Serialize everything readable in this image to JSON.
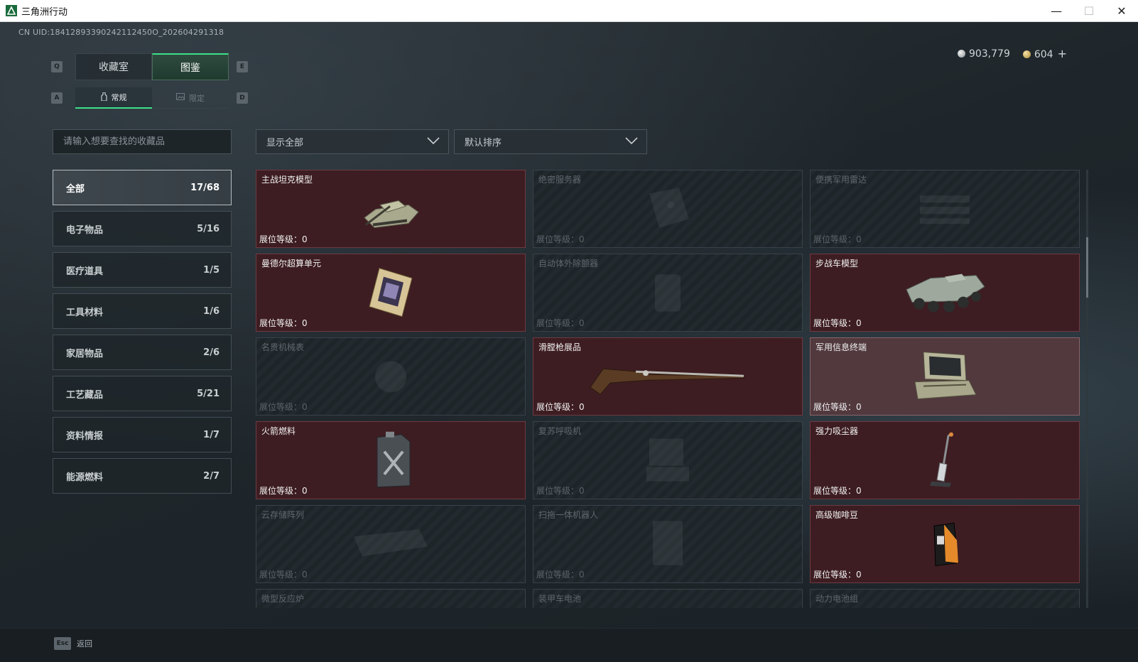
{
  "window": {
    "title": "三角洲行动",
    "minimize": "—",
    "maximize": "☐",
    "close": "✕"
  },
  "uid": "CN UID:18412893390242112450O_202604291318",
  "currency": {
    "silver": "903,779",
    "gold": "604",
    "add": "+"
  },
  "tabs_top": [
    {
      "label": "收藏室",
      "key": "Q",
      "active": false
    },
    {
      "label": "图鉴",
      "key": "E",
      "active": true
    }
  ],
  "tabs_sub": [
    {
      "label": "常规",
      "key": "A",
      "active": true
    },
    {
      "label": "限定",
      "key": "D",
      "active": false
    }
  ],
  "search": {
    "placeholder": "请输入想要查找的收藏品"
  },
  "filters": {
    "show": "显示全部",
    "sort": "默认排序"
  },
  "categories": [
    {
      "label": "全部",
      "count": "17/68",
      "active": true
    },
    {
      "label": "电子物品",
      "count": "5/16"
    },
    {
      "label": "医疗道具",
      "count": "1/5"
    },
    {
      "label": "工具材料",
      "count": "1/6"
    },
    {
      "label": "家居物品",
      "count": "2/6"
    },
    {
      "label": "工艺藏品",
      "count": "5/21"
    },
    {
      "label": "资料情报",
      "count": "1/7"
    },
    {
      "label": "能源燃料",
      "count": "2/7"
    }
  ],
  "level_label": "展位等级：",
  "items": [
    {
      "name": "主战坦克模型",
      "level": "0",
      "owned": true,
      "icon": "tank-icon"
    },
    {
      "name": "绝密服务器",
      "level": "0",
      "owned": false,
      "icon": "server-icon"
    },
    {
      "name": "便携军用雷达",
      "level": "0",
      "owned": false,
      "icon": "radar-icon"
    },
    {
      "name": "曼德尔超算单元",
      "level": "0",
      "owned": true,
      "icon": "cpu-icon"
    },
    {
      "name": "自动体外除颤器",
      "level": "0",
      "owned": false,
      "icon": "defibrillator-icon"
    },
    {
      "name": "步战车模型",
      "level": "0",
      "owned": true,
      "icon": "ifv-icon"
    },
    {
      "name": "名贵机械表",
      "level": "0",
      "owned": false,
      "icon": "watch-icon"
    },
    {
      "name": "滑膛枪展品",
      "level": "0",
      "owned": true,
      "icon": "musket-icon"
    },
    {
      "name": "军用信息终端",
      "level": "0",
      "owned": true,
      "highlighted": true,
      "icon": "terminal-icon"
    },
    {
      "name": "火箭燃料",
      "level": "0",
      "owned": true,
      "icon": "fuel-can-icon"
    },
    {
      "name": "复苏呼吸机",
      "level": "0",
      "owned": false,
      "icon": "ventilator-icon"
    },
    {
      "name": "强力吸尘器",
      "level": "0",
      "owned": true,
      "icon": "vacuum-icon"
    },
    {
      "name": "云存储阵列",
      "level": "0",
      "owned": false,
      "icon": "storage-icon"
    },
    {
      "name": "扫拖一体机器人",
      "level": "0",
      "owned": false,
      "icon": "robot-icon"
    },
    {
      "name": "高级咖啡豆",
      "level": "0",
      "owned": true,
      "icon": "coffee-bag-icon"
    },
    {
      "name": "微型反应炉",
      "owned": false,
      "icon": "reactor-icon"
    },
    {
      "name": "装甲车电池",
      "owned": false,
      "icon": "battery-icon"
    },
    {
      "name": "动力电池组",
      "owned": false,
      "icon": "battery-pack-icon"
    }
  ],
  "footer": {
    "key": "Esc",
    "label": "返回"
  }
}
